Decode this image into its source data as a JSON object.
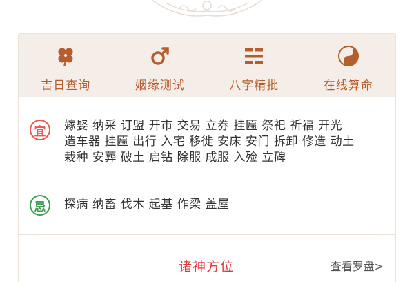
{
  "nav": [
    {
      "label": "吉日查询",
      "icon": "clover-icon"
    },
    {
      "label": "姻缘测试",
      "icon": "gender-symbol-icon"
    },
    {
      "label": "八字精批",
      "icon": "trigram-icon"
    },
    {
      "label": "在线算命",
      "icon": "yin-yang-icon"
    }
  ],
  "yi": {
    "badge": "宜",
    "lines": [
      "嫁娶 纳采 订盟 开市 交易 立券 挂匾 祭祀 祈福 开光",
      "造车器 挂匾 出行 入宅 移徙 安床 安门 拆卸 修造 动土",
      "栽种 安葬 破土 启钻 除服 成服 入殓 立碑"
    ]
  },
  "ji": {
    "badge": "忌",
    "text": "探病 纳畜 伐木 起基 作梁 盖屋"
  },
  "footer": {
    "title": "诸神方位",
    "link": "查看罗盘>"
  },
  "colors": {
    "accent_brown": "#b65d2e",
    "nav_background": "#f5ede7",
    "yi_red": "#e9574f",
    "ji_green": "#3f9e52",
    "title_red": "#e2373a"
  }
}
